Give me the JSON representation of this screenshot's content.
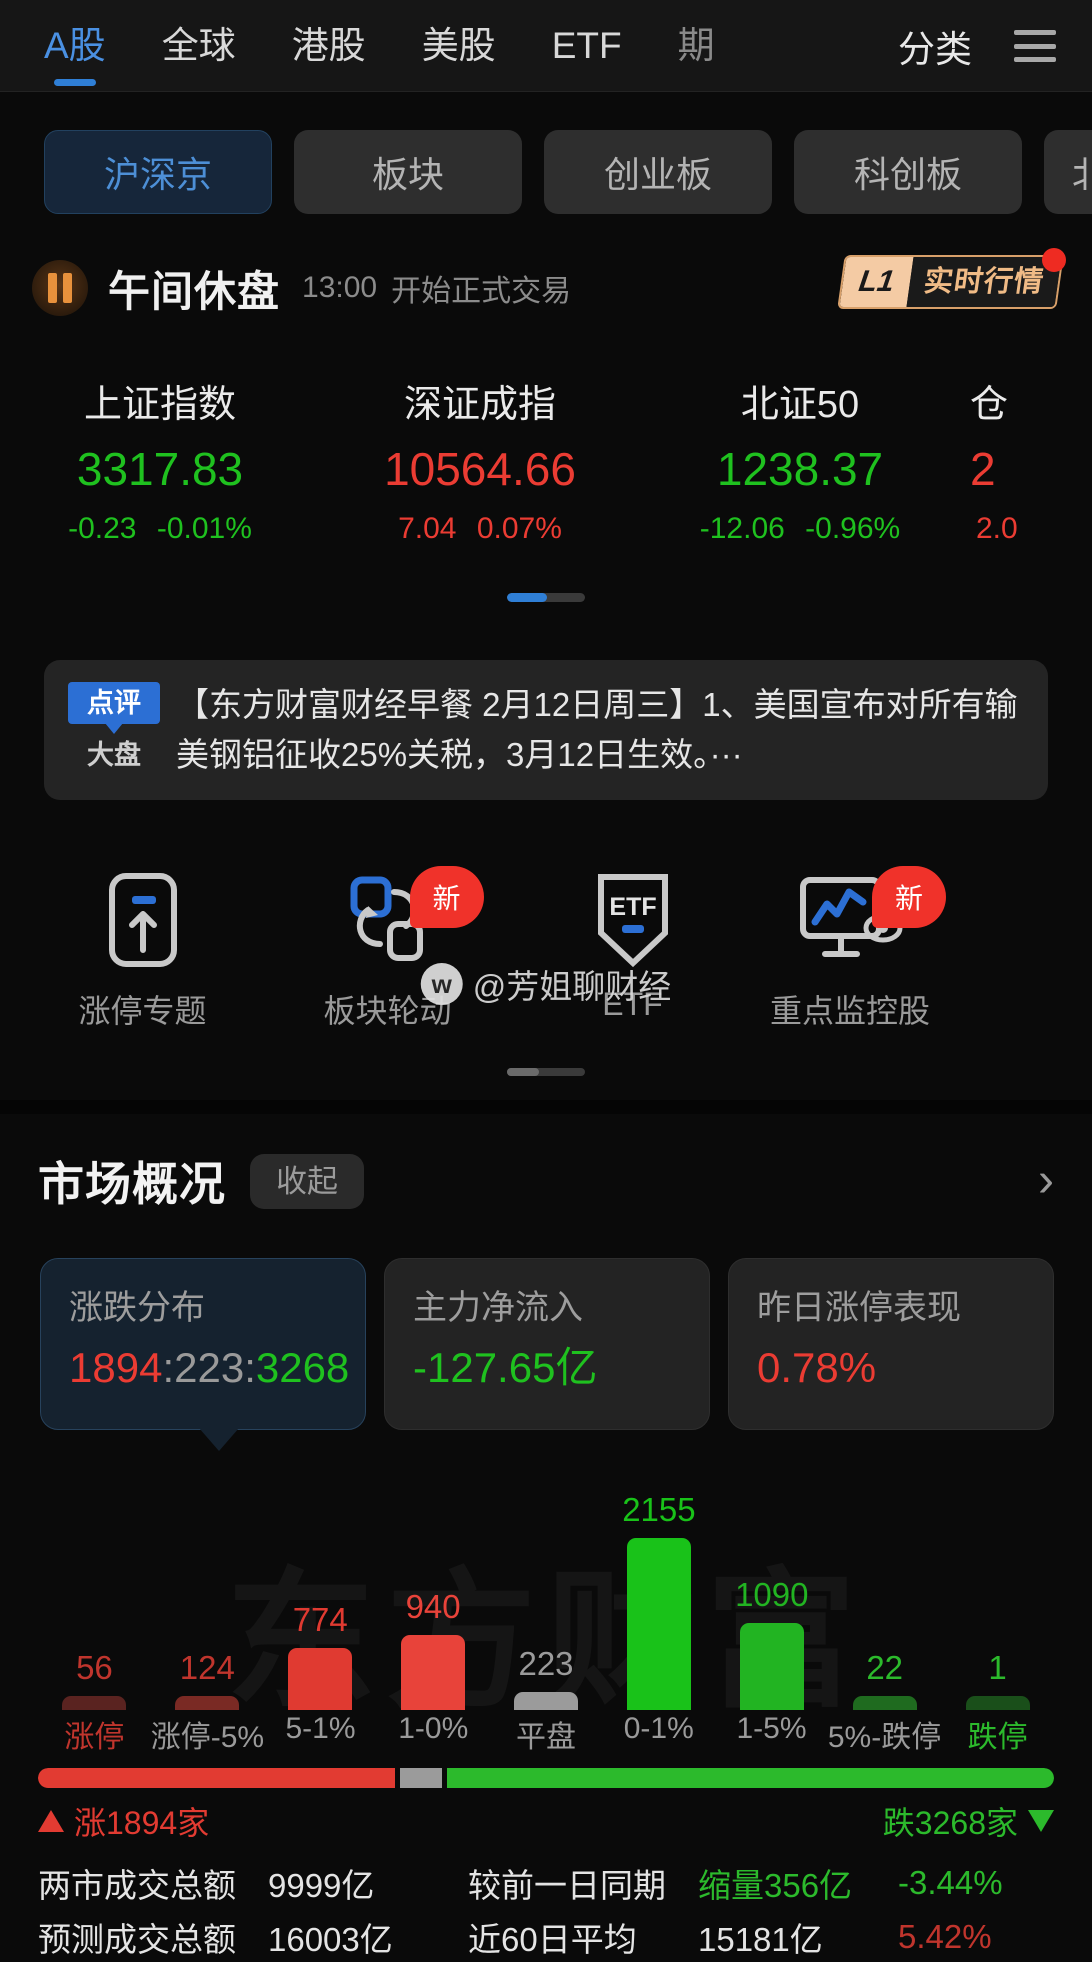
{
  "topnav": {
    "items": [
      {
        "label": "A股",
        "active": true
      },
      {
        "label": "全球",
        "active": false
      },
      {
        "label": "港股",
        "active": false
      },
      {
        "label": "美股",
        "active": false
      },
      {
        "label": "ETF",
        "active": false
      },
      {
        "label": "期",
        "active": false
      }
    ],
    "category_label": "分类",
    "menu_icon": "hamburger-icon"
  },
  "chips": [
    {
      "label": "沪深京",
      "active": true
    },
    {
      "label": "板块",
      "active": false
    },
    {
      "label": "创业板",
      "active": false
    },
    {
      "label": "科创板",
      "active": false
    },
    {
      "label": "北",
      "active": false
    }
  ],
  "status": {
    "title": "午间休盘",
    "time": "13:00",
    "note": "开始正式交易",
    "badge_level": "L1",
    "badge_label": "实时行情"
  },
  "indices": [
    {
      "name": "上证指数",
      "value": "3317.83",
      "change": "-0.23",
      "percent": "-0.01%",
      "dir": "down"
    },
    {
      "name": "深证成指",
      "value": "10564.66",
      "change": "7.04",
      "percent": "0.07%",
      "dir": "up"
    },
    {
      "name": "北证50",
      "value": "1238.37",
      "change": "-12.06",
      "percent": "-0.96%",
      "dir": "down"
    },
    {
      "name": "仓",
      "value": "2",
      "change": "2.0",
      "percent": "",
      "dir": "up"
    }
  ],
  "news": {
    "tag_top": "点评",
    "tag_bottom": "大盘",
    "text": "【东方财富财经早餐 2月12日周三】1、美国宣布对所有输美钢铝征收25%关税，3月12日生效。···"
  },
  "quick_icons": [
    {
      "label": "涨停专题",
      "icon": "upload-box-icon",
      "badge": ""
    },
    {
      "label": "板块轮动",
      "icon": "rotation-icon",
      "badge": "新"
    },
    {
      "label": "ETF",
      "icon": "etf-shield-icon",
      "badge": ""
    },
    {
      "label": "重点监控股",
      "icon": "monitor-eye-icon",
      "badge": "新"
    }
  ],
  "watermark": {
    "weibo": "@芳姐聊财经",
    "big": "东方财富"
  },
  "market_overview": {
    "title": "市场概况",
    "collapse_label": "收起",
    "arrow_icon": "chevron-right-icon",
    "cards": [
      {
        "title": "涨跌分布",
        "parts": [
          {
            "text": "1894",
            "color": "up"
          },
          {
            "text": ":",
            "color": "sep"
          },
          {
            "text": "223",
            "color": "sep"
          },
          {
            "text": ":",
            "color": "sep"
          },
          {
            "text": "3268",
            "color": "down"
          }
        ],
        "active": true
      },
      {
        "title": "主力净流入",
        "parts": [
          {
            "text": "-127.65亿",
            "color": "down"
          }
        ],
        "active": false
      },
      {
        "title": "昨日涨停表现",
        "parts": [
          {
            "text": "0.78%",
            "color": "up"
          }
        ],
        "active": false
      }
    ]
  },
  "chart_data": {
    "type": "bar",
    "title": "涨跌分布",
    "categories": [
      "涨停",
      "涨停-5%",
      "5-1%",
      "1-0%",
      "平盘",
      "0-1%",
      "1-5%",
      "5%-跌停",
      "跌停"
    ],
    "values": [
      56,
      124,
      774,
      940,
      223,
      2155,
      1090,
      22,
      1
    ],
    "bar_colors": [
      "#5a2320",
      "#7a2a24",
      "#e03a31",
      "#e8433a",
      "#9b9b9b",
      "#19c219",
      "#22b422",
      "#1f6b1f",
      "#1a4f1a"
    ],
    "label_colors": [
      "#c0352d",
      "#c0352d",
      "#e03a31",
      "#e8433a",
      "#9b9b9b",
      "#19c219",
      "#22b422",
      "#2cba2c",
      "#2cba2c"
    ],
    "axis_label_colors": [
      "#c0352d",
      "#9a9a9a",
      "#9a9a9a",
      "#9a9a9a",
      "#9a9a9a",
      "#9a9a9a",
      "#9a9a9a",
      "#9a9a9a",
      "#2cba2c"
    ],
    "ylim": [
      0,
      2155
    ],
    "grid": false,
    "xlabel": "",
    "ylabel": ""
  },
  "ratio": {
    "up_count": 1894,
    "flat_count": 223,
    "down_count": 3268,
    "up_label": "涨1894家",
    "down_label": "跌3268家"
  },
  "summary": {
    "rows": [
      {
        "label": "两市成交总额",
        "value": "9999亿",
        "label2": "较前一日同期",
        "value2": "缩量356亿",
        "value2_color": "green",
        "value3": "-3.44%",
        "value3_color": "green"
      },
      {
        "label": "预测成交总额",
        "value": "16003亿",
        "label2": "近60日平均",
        "value2": "15181亿",
        "value2_color": "",
        "value3": "5.42%",
        "value3_color": "red"
      }
    ]
  }
}
